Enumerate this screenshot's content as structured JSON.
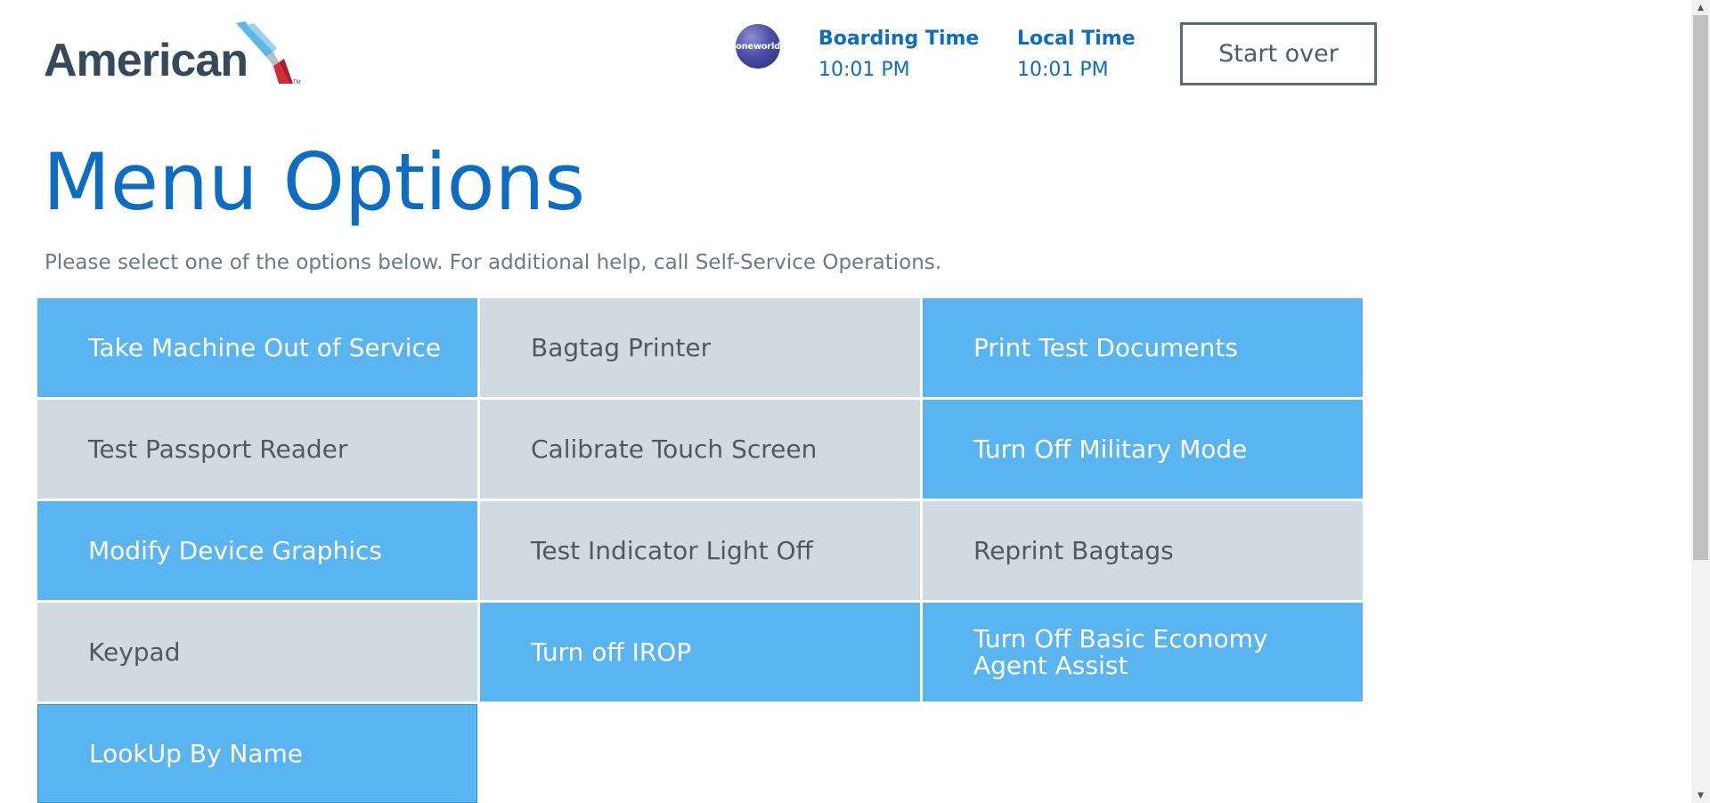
{
  "header": {
    "logo_text": "American",
    "oneworld_text": "oneworld",
    "boarding_label": "Boarding Time",
    "boarding_value": "10:01 PM",
    "local_label": "Local Time",
    "local_value": "10:01 PM",
    "start_over_label": "Start over"
  },
  "main": {
    "title": "Menu Options",
    "subtitle": "Please select one of the options below. For additional help, call Self-Service Operations."
  },
  "menu": {
    "items": [
      {
        "label": "Take Machine Out of Service",
        "style": "blue"
      },
      {
        "label": "Bagtag Printer",
        "style": "gray"
      },
      {
        "label": "Print Test Documents",
        "style": "blue"
      },
      {
        "label": "Test Passport Reader",
        "style": "gray"
      },
      {
        "label": "Calibrate Touch Screen",
        "style": "gray"
      },
      {
        "label": "Turn Off Military Mode",
        "style": "blue"
      },
      {
        "label": "Modify Device Graphics",
        "style": "blue"
      },
      {
        "label": "Test Indicator Light Off",
        "style": "gray"
      },
      {
        "label": "Reprint Bagtags",
        "style": "gray"
      },
      {
        "label": "Keypad",
        "style": "gray"
      },
      {
        "label": "Turn off IROP",
        "style": "blue"
      },
      {
        "label": "Turn Off Basic Economy Agent Assist",
        "style": "blue"
      },
      {
        "label": "LookUp By Name",
        "style": "blue"
      }
    ]
  },
  "colors": {
    "brand_blue": "#0e6cc2",
    "tile_blue": "#5ab4ef",
    "tile_gray": "#d0dbe1"
  }
}
